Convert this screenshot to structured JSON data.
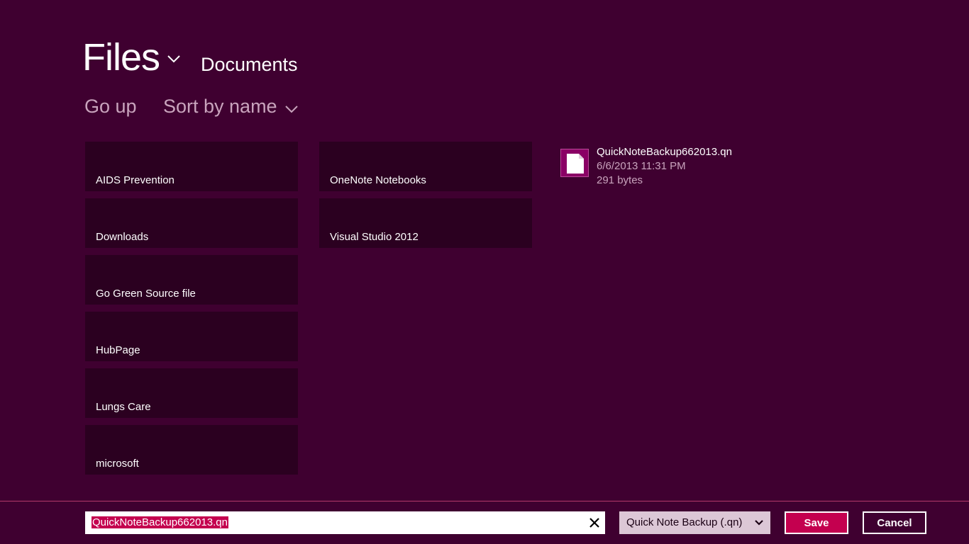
{
  "header": {
    "title": "Files",
    "location": "Documents",
    "title_chevron_icon": "chevron-down-icon"
  },
  "commands": {
    "go_up": "Go up",
    "sort": "Sort by name",
    "sort_chevron_icon": "chevron-down-icon"
  },
  "folders": [
    {
      "label": "AIDS Prevention"
    },
    {
      "label": "Downloads"
    },
    {
      "label": "Go Green Source file"
    },
    {
      "label": "HubPage"
    },
    {
      "label": "Lungs Care"
    },
    {
      "label": "microsoft"
    },
    {
      "label": "OneNote Notebooks"
    },
    {
      "label": "Visual Studio 2012"
    }
  ],
  "file": {
    "name": "QuickNoteBackup662013.qn",
    "date": "6/6/2013 11:31 PM",
    "size": "291 bytes",
    "icon": "document-icon"
  },
  "footer": {
    "filename_value": "QuickNoteBackup662013.qn",
    "clear_icon": "close-icon",
    "file_type": "Quick Note Backup (.qn)",
    "file_type_chevron_icon": "chevron-down-icon",
    "save_label": "Save",
    "cancel_label": "Cancel"
  },
  "colors": {
    "background": "#3f0030",
    "tile": "#2b0020",
    "accent": "#c4004f",
    "secondary_text": "#c9a4bd"
  }
}
